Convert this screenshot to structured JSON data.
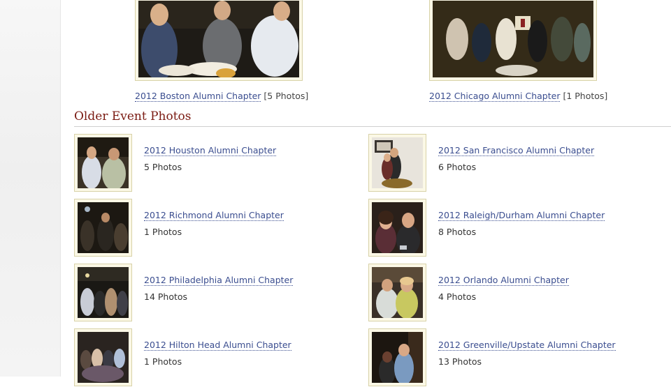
{
  "featured": [
    {
      "title": "2012 Boston Alumni Chapter",
      "count": "[5 Photos]"
    },
    {
      "title": "2012 Chicago Alumni Chapter",
      "count": "[1 Photos]"
    }
  ],
  "section": {
    "title": "Older Event Photos"
  },
  "events": [
    {
      "title": "2012 Houston Alumni Chapter",
      "count": "5 Photos"
    },
    {
      "title": "2012 San Francisco Alumni Chapter",
      "count": "6 Photos"
    },
    {
      "title": "2012 Richmond Alumni Chapter",
      "count": "1 Photos"
    },
    {
      "title": "2012 Raleigh/Durham Alumni Chapter",
      "count": "8 Photos"
    },
    {
      "title": "2012 Philadelphia Alumni Chapter",
      "count": "14 Photos"
    },
    {
      "title": "2012 Orlando Alumni Chapter",
      "count": "4 Photos"
    },
    {
      "title": "2012 Hilton Head Alumni Chapter",
      "count": "1 Photos"
    },
    {
      "title": "2012 Greenville/Upstate Alumni Chapter",
      "count": "13 Photos"
    }
  ],
  "colors": {
    "link": "#3a4d8f",
    "heading": "#7a1a12",
    "frame": "#fbf8e6"
  }
}
